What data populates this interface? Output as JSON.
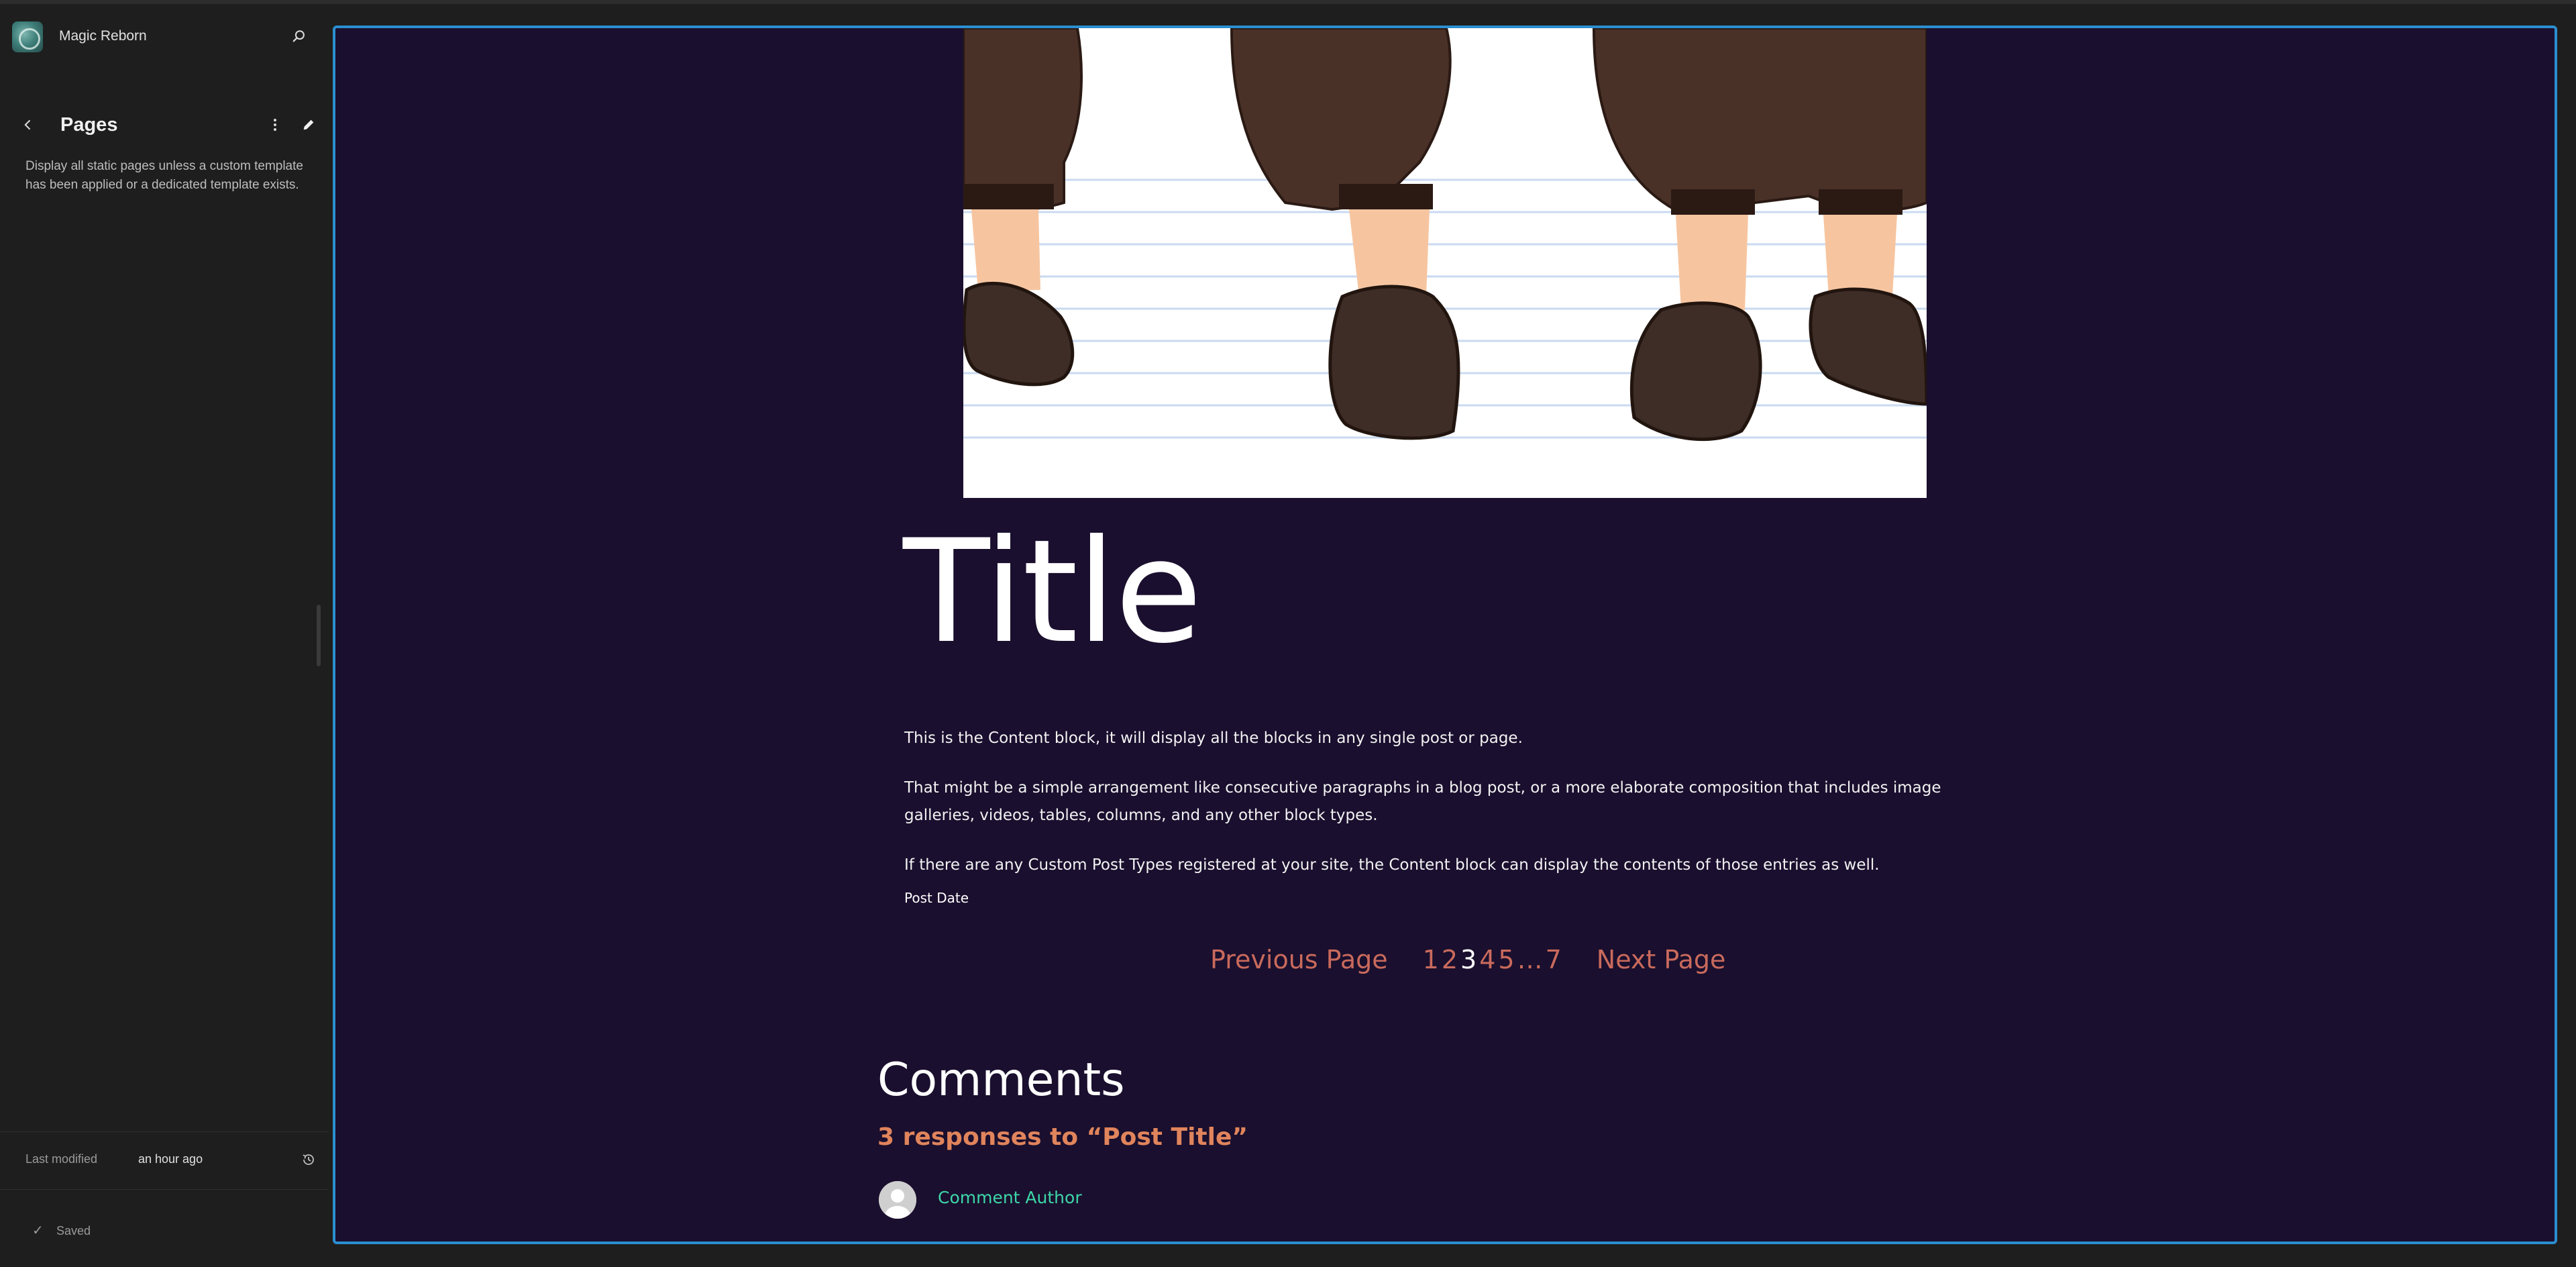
{
  "sidebar": {
    "site_name": "Magic Reborn",
    "section_title": "Pages",
    "description": "Display all static pages unless a custom template has been applied or a dedicated template exists.",
    "last_modified_label": "Last modified",
    "last_modified_value": "an hour ago",
    "saved_label": "Saved"
  },
  "colors": {
    "canvas_background": "#1a0f2e",
    "frame_border": "#2b8ed0",
    "pagination_link": "#c96a5c",
    "responses_accent": "#e0845c",
    "author_link": "#3dd6a8"
  },
  "post": {
    "title": "Title",
    "paragraphs": [
      "This is the Content block, it will display all the blocks in any single post or page.",
      "That might be a simple arrangement like consecutive paragraphs in a blog post, or a more elaborate composition that includes image galleries, videos, tables, columns, and any other block types.",
      "If there are any Custom Post Types registered at your site, the Content block can display the contents of those entries as well."
    ],
    "date_label": "Post Date"
  },
  "pagination": {
    "previous_label": "Previous Page",
    "pages": [
      "1",
      "2",
      "3",
      "4",
      "5"
    ],
    "current_page": "3",
    "ellipsis": "…",
    "last_page": "7",
    "next_label": "Next Page"
  },
  "comments": {
    "heading": "Comments",
    "responses_title": "3 responses to “Post Title”",
    "author": "Comment Author"
  }
}
